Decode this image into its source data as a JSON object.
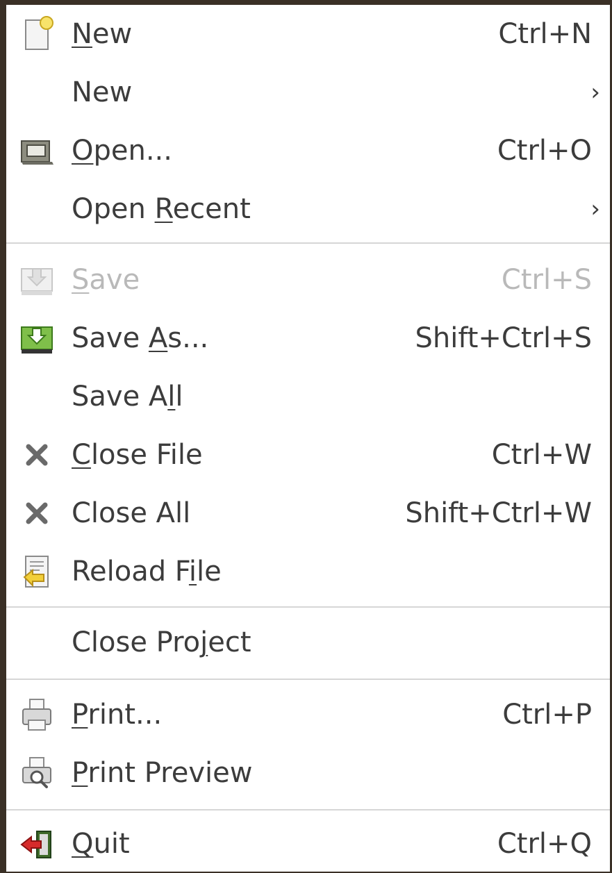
{
  "menu": {
    "items": [
      {
        "pre": "",
        "mn": "N",
        "post": "ew",
        "accel": "Ctrl+N",
        "icon": "new-document-icon"
      },
      {
        "pre": "New",
        "mn": "",
        "post": "",
        "submenu": "›"
      },
      {
        "pre": "",
        "mn": "O",
        "post": "pen...",
        "accel": "Ctrl+O",
        "icon": "open-folder-icon"
      },
      {
        "pre": "Open ",
        "mn": "R",
        "post": "ecent",
        "submenu": "›"
      },
      {
        "pre": "",
        "mn": "S",
        "post": "ave",
        "accel": "Ctrl+S",
        "icon": "save-icon",
        "disabled": true
      },
      {
        "pre": "Save ",
        "mn": "A",
        "post": "s...",
        "accel": "Shift+Ctrl+S",
        "icon": "save-as-icon"
      },
      {
        "pre": "Save A",
        "mn": "l",
        "post": "l"
      },
      {
        "pre": "",
        "mn": "C",
        "post": "lose File",
        "accel": "Ctrl+W",
        "icon": "close-icon"
      },
      {
        "pre": "Close All",
        "mn": "",
        "post": "",
        "accel": "Shift+Ctrl+W",
        "icon": "close-all-icon"
      },
      {
        "pre": "Reload F",
        "mn": "i",
        "post": "le",
        "icon": "reload-icon"
      },
      {
        "pre": "Close Pro",
        "mn": "j",
        "post": "ect"
      },
      {
        "pre": "",
        "mn": "P",
        "post": "rint...",
        "accel": "Ctrl+P",
        "icon": "print-icon"
      },
      {
        "pre": "",
        "mn": "P",
        "post": "rint Preview",
        "icon": "print-preview-icon"
      },
      {
        "pre": "",
        "mn": "Q",
        "post": "uit",
        "accel": "Ctrl+Q",
        "icon": "quit-icon"
      }
    ]
  }
}
